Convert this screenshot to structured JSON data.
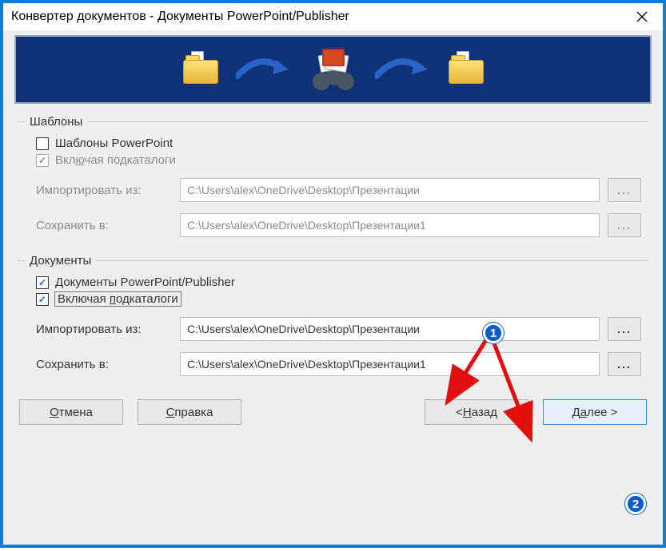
{
  "title": "Конвертер документов - Документы PowerPoint/Publisher",
  "templates": {
    "legend": "Шаблоны",
    "ppt_checkbox": {
      "checked": false,
      "label": "Шаблоны PowerPoint"
    },
    "subdirs_checkbox": {
      "checked": true,
      "label_pre": "Вкл",
      "label_ul": "ю",
      "label_post": "чая подкаталоги"
    },
    "import_label": "Импортировать из:",
    "import_value": "C:\\Users\\alex\\OneDrive\\Desktop\\Презентации",
    "save_label_pre": "Сохранить ",
    "save_label_ul": "в",
    "save_label_post": ":",
    "save_value": "C:\\Users\\alex\\OneDrive\\Desktop\\Презентации1",
    "browse": "..."
  },
  "documents": {
    "legend": "Документы",
    "ppt_checkbox": {
      "checked": true,
      "label": "Документы PowerPoint/Publisher"
    },
    "subdirs_checkbox": {
      "checked": true,
      "label_pre": "Включая ",
      "label_ul": "п",
      "label_post": "одкаталоги"
    },
    "import_label": "Импортировать из:",
    "import_value": "C:\\Users\\alex\\OneDrive\\Desktop\\Презентации",
    "save_label_pre": "Сохранить ",
    "save_label_ul": "в",
    "save_label_post": ":",
    "save_value": "C:\\Users\\alex\\OneDrive\\Desktop\\Презентации1",
    "browse": "..."
  },
  "buttons": {
    "cancel_ul": "О",
    "cancel_post": "тмена",
    "help_ul": "С",
    "help_post": "правка",
    "back_pre": "< ",
    "back_ul": "Н",
    "back_post": "азад",
    "next_pre": "Д",
    "next_ul": "а",
    "next_post": "лее >"
  },
  "annotations": {
    "n1": "1",
    "n2": "2"
  }
}
